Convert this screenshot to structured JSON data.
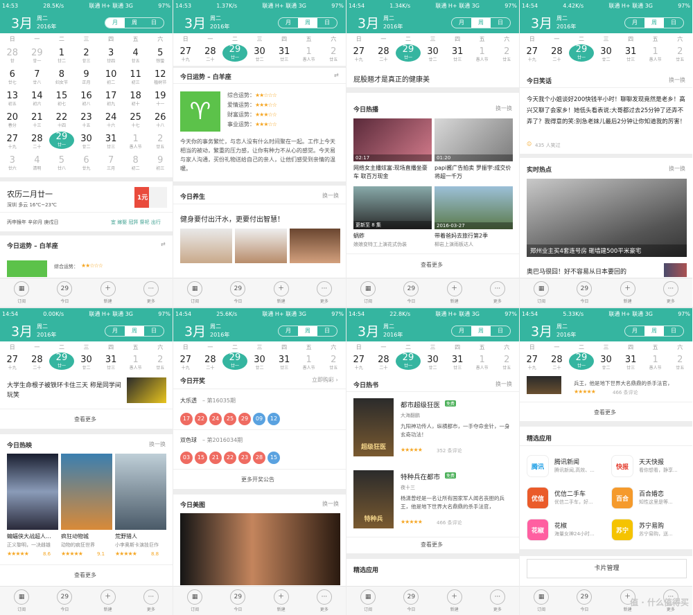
{
  "calendar": {
    "month": "3月",
    "weekday": "周二",
    "year": "2016年",
    "view_tabs": [
      "月",
      "周",
      "日"
    ],
    "weekdays": [
      "日",
      "一",
      "二",
      "三",
      "四",
      "五",
      "六"
    ],
    "month_grid": [
      [
        [
          "28",
          "廿"
        ],
        [
          "29",
          "廿一"
        ],
        [
          "1",
          "廿二"
        ],
        [
          "2",
          "廿三"
        ],
        [
          "3",
          "廿四"
        ],
        [
          "4",
          "廿五"
        ],
        [
          "5",
          "惊蛰"
        ]
      ],
      [
        [
          "6",
          "廿七"
        ],
        [
          "7",
          "廿八"
        ],
        [
          "8",
          "妇女节"
        ],
        [
          "9",
          "正月"
        ],
        [
          "10",
          "初二"
        ],
        [
          "11",
          "初三"
        ],
        [
          "12",
          "植树节"
        ]
      ],
      [
        [
          "13",
          "初五"
        ],
        [
          "14",
          "初六"
        ],
        [
          "15",
          "初七"
        ],
        [
          "16",
          "初八"
        ],
        [
          "17",
          "初九"
        ],
        [
          "18",
          "初十"
        ],
        [
          "19",
          "十一"
        ]
      ],
      [
        [
          "20",
          "春分"
        ],
        [
          "21",
          "十三"
        ],
        [
          "22",
          "十四"
        ],
        [
          "23",
          "十五"
        ],
        [
          "24",
          "十六"
        ],
        [
          "25",
          "十七"
        ],
        [
          "26",
          "十八"
        ]
      ],
      [
        [
          "27",
          "十九"
        ],
        [
          "28",
          "二十"
        ],
        [
          "29",
          "廿一"
        ],
        [
          "30",
          "廿二"
        ],
        [
          "31",
          "廿三"
        ],
        [
          "1",
          "愚人节"
        ],
        [
          "2",
          "廿五"
        ]
      ],
      [
        [
          "3",
          "廿六"
        ],
        [
          "4",
          "清明"
        ],
        [
          "5",
          "廿八"
        ],
        [
          "6",
          "廿九"
        ],
        [
          "7",
          "三月"
        ],
        [
          "8",
          "初二"
        ],
        [
          "9",
          "初三"
        ]
      ]
    ],
    "week_row": [
      [
        "27",
        "十九"
      ],
      [
        "28",
        "二十"
      ],
      [
        "29",
        "廿一"
      ],
      [
        "30",
        "廿二"
      ],
      [
        "31",
        "廿三"
      ],
      [
        "1",
        "愚人节"
      ],
      [
        "2",
        "廿五"
      ]
    ],
    "selected": "29"
  },
  "status_bars": [
    {
      "time": "14:53",
      "speed": "28.5K/s",
      "net": "联通 H+  联通 3G",
      "battery": "97%"
    },
    {
      "time": "14:53",
      "speed": "1.37K/s",
      "net": "联通 H+  联通 3G",
      "battery": "97%"
    },
    {
      "time": "14:54",
      "speed": "1.34K/s",
      "net": "联通 H+  联通 3G",
      "battery": "97%"
    },
    {
      "time": "14:54",
      "speed": "4.42K/s",
      "net": "联通 H+  联通 3G",
      "battery": "97%"
    },
    {
      "time": "14:54",
      "speed": "0.00K/s",
      "net": "联通 H+  联通 3G",
      "battery": "97%"
    },
    {
      "time": "14:54",
      "speed": "25.6K/s",
      "net": "联通 H+  联通 3G",
      "battery": "97%"
    },
    {
      "time": "14:54",
      "speed": "22.8K/s",
      "net": "联通 H+  联通 3G",
      "battery": "97%"
    },
    {
      "time": "14:54",
      "speed": "5.33K/s",
      "net": "联通 H+  联通 3G",
      "battery": "97%"
    }
  ],
  "bottom_nav": [
    {
      "icon": "▦",
      "label": "订阅"
    },
    {
      "icon": "29",
      "label": "今日"
    },
    {
      "icon": "＋",
      "label": "新建"
    },
    {
      "icon": "···",
      "label": "更多"
    }
  ],
  "p1": {
    "lunar": "农历二月廿一",
    "weather": "深圳  多云  16℃~23℃",
    "ganzhi": "丙申猴年 辛卯月 庚戌日",
    "yi": "宜 嫁娶 冠笄 祭祀 出行",
    "fortune_title": "今日运势 – 白羊座",
    "fortune_first": "综合运势：",
    "badge": "1元"
  },
  "p2": {
    "fortune_title": "今日运势 – 白羊座",
    "ratings": [
      {
        "label": "综合运势：",
        "stars": "★★☆☆☆"
      },
      {
        "label": "爱情运势：",
        "stars": "★★★☆☆"
      },
      {
        "label": "财富运势：",
        "stars": "★★★☆☆"
      },
      {
        "label": "事业运势：",
        "stars": "★★★☆☆"
      }
    ],
    "fortune_text": "今天你的事务繁忙，与恋人没有什么时间聚在一起。工作上今天相当的被动，繁重的压力感，让你有种力不从心的感觉。今天易与家人沟通，买份礼物送给自己的亲人，让他们感受到亲情的温暖。",
    "health_title": "今日养生",
    "health_more": "换一换",
    "health_headline": "健身要付出汗水，更要付出智慧！"
  },
  "p3": {
    "top_headline": "屁股翘才是真正的健康美",
    "hot_title": "今日热播",
    "hot_more": "换一换",
    "videos": [
      {
        "dur": "02:17",
        "title": "网络女主播炫富:现场直播坐豪车 取百万现金"
      },
      {
        "dur": "01:20",
        "title": "papi酱广告拍卖 罗振宇:成交价将超一千万"
      },
      {
        "dur": "更新至 8 集",
        "title": "蜗蚱",
        "sub": "娘娘变特工上演花式伪装"
      },
      {
        "dur": "2016-03-27",
        "title": "带着爸妈去旅行第2季",
        "sub": "柳岩上演雨板达人"
      }
    ],
    "see_more": "查看更多"
  },
  "p4": {
    "joke_title": "今日笑话",
    "joke_more": "换一换",
    "joke_text": "今天我个小姐谈好200快钱半小时！聊聊发现竟然是老乡！高兴又聊了会家乡！她低头看表说:大哥都过去25分钟了还弄不弄了？我得意的笑:别急老妹儿最后2分钟让你知道我的厉害！",
    "laugh": "435 人笑过",
    "hot_title": "实时热点",
    "hot_more": "换一换",
    "hot_caption": "郑州业主买4套连号房 砸墙建500平米豪宅",
    "next_headline": "奥巴马很囧！好不容易从日本要回的"
  },
  "p5": {
    "news_text": "大学生命根子被铁环卡住三天 称是同学间玩笑",
    "see_more": "查看更多",
    "movie_title": "今日热映",
    "movie_more": "换一换",
    "movies": [
      {
        "name": "蝙蝠侠大战超人...",
        "desc": "正义黎明，一决雌雄",
        "score": "8.6"
      },
      {
        "name": "疯狂动物城",
        "desc": "动物的疯狂世界",
        "score": "9.1"
      },
      {
        "name": "荒野猎人",
        "desc": "小李奥斯卡演技巨作",
        "score": "8.8"
      }
    ],
    "see_more2": "查看更多"
  },
  "p6": {
    "lottery_title": "今日开奖",
    "lottery_link": "立即购彩 ›",
    "dlt_name": "大乐透",
    "dlt_issue": "– 第16035期",
    "dlt_red": [
      "17",
      "22",
      "24",
      "25",
      "29"
    ],
    "dlt_blue": [
      "09",
      "12"
    ],
    "ssq_name": "双色球",
    "ssq_issue": "– 第2016034期",
    "ssq_red": [
      "03",
      "15",
      "21",
      "22",
      "23",
      "28"
    ],
    "ssq_blue": [
      "15"
    ],
    "lottery_more": "更多开奖公告",
    "pic_title": "今日美图",
    "pic_more": "换一换"
  },
  "p7": {
    "book_title": "今日热书",
    "book_more": "换一换",
    "books": [
      {
        "name": "都市超级狂医",
        "tag": "免费",
        "author": "大海翻鹏",
        "desc": "九阳神功传人，纵横都市，一手夺命金针，一身玄奇功法！",
        "comments": "352 条评论",
        "cover": "超级狂医"
      },
      {
        "name": "特种兵在都市",
        "tag": "免费",
        "author": "夜十三",
        "desc": "杨潇曾经是一名让所有国家军人闻名丧胆的兵王，他是地下世界大名鼎鼎的杀手法官，",
        "comments": "466 条评论",
        "cover": "特种兵"
      }
    ],
    "see_more": "查看更多",
    "apps_title": "精选应用"
  },
  "p8": {
    "prev_text": "兵王，他是地下世界大名鼎鼎的杀手法官，",
    "prev_comments": "466 条评论",
    "see_more": "查看更多",
    "apps_title": "精选应用",
    "apps": [
      {
        "name": "腾讯新闻",
        "desc": "腾讯新闻,高效、...",
        "icon": "腾讯",
        "color": "#ffffff",
        "fg": "#1d9ee5"
      },
      {
        "name": "天天快报",
        "desc": "看你想看，静享...",
        "icon": "快报",
        "color": "#ffffff",
        "fg": "#e43b2c"
      },
      {
        "name": "优信二手车",
        "desc": "优信二手车，好...",
        "icon": "优信",
        "color": "#ea5b2a",
        "fg": "#ffffff"
      },
      {
        "name": "百合婚恋",
        "desc": "知性这里是等...",
        "icon": "百合",
        "color": "#f59a2c",
        "fg": "#ffffff"
      },
      {
        "name": "花椒",
        "desc": "海量女神24小时...",
        "icon": "花椒",
        "color": "#ff5fa1",
        "fg": "#ffffff"
      },
      {
        "name": "苏宁易购",
        "desc": "苏宁易购，送...",
        "icon": "苏宁",
        "color": "#f5c300",
        "fg": "#ffffff"
      }
    ],
    "card_manage": "卡片管理",
    "watermark": "值 · 什么值得买"
  }
}
